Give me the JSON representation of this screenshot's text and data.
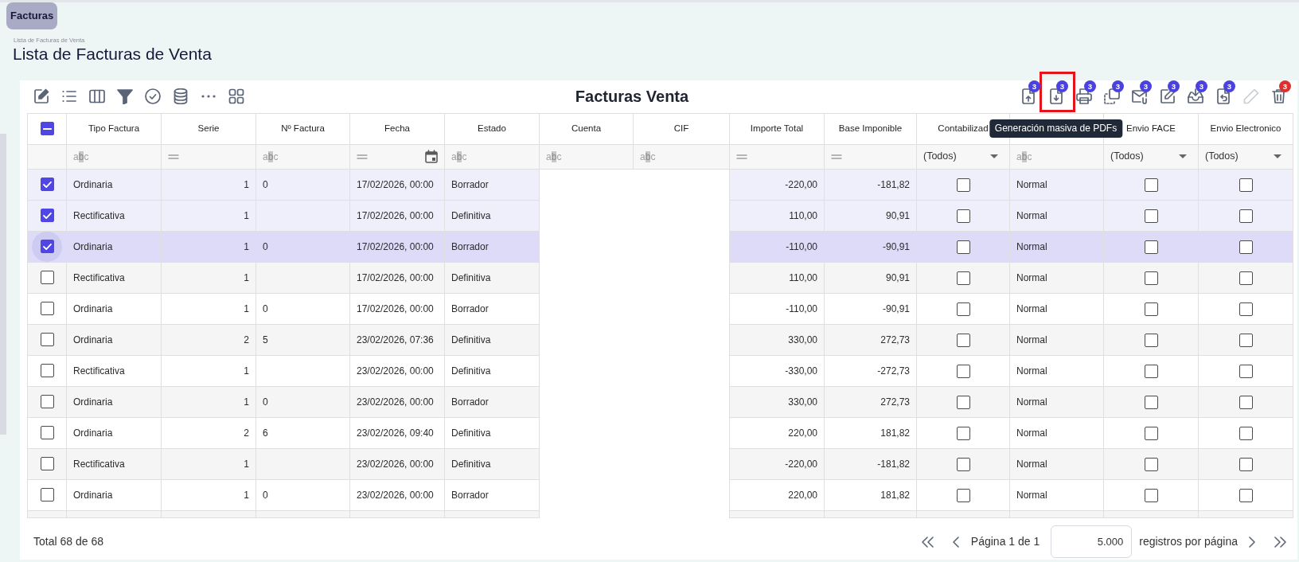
{
  "tab": {
    "label": "Facturas",
    "selected": true
  },
  "breadcrumb": "Lista de Facturas de Venta",
  "page_title": "Lista de Facturas de Venta",
  "grid": {
    "title": "Facturas Venta",
    "left_tools": [
      {
        "kind": "edit"
      },
      {
        "kind": "list"
      },
      {
        "kind": "columns"
      },
      {
        "kind": "filter"
      },
      {
        "kind": "check"
      },
      {
        "kind": "database"
      },
      {
        "kind": "more"
      },
      {
        "kind": "apps"
      }
    ],
    "right_tools": [
      {
        "kind": "upload",
        "badge": {
          "text": "3",
          "color": "#4b41e1"
        },
        "disabled": false,
        "highlighted": false
      },
      {
        "kind": "download",
        "badge": {
          "text": "3",
          "color": "#4b41e1"
        },
        "disabled": false,
        "highlighted": true,
        "tooltip": "Generación masiva de PDFs"
      },
      {
        "kind": "print",
        "badge": {
          "text": "3",
          "color": "#4b41e1"
        },
        "disabled": false,
        "highlighted": false
      },
      {
        "kind": "copy",
        "badge": {
          "text": "3",
          "color": "#4b41e1"
        },
        "disabled": false,
        "highlighted": false
      },
      {
        "kind": "mail",
        "badge": {
          "text": "3",
          "color": "#4b41e1"
        },
        "disabled": false,
        "highlighted": false
      },
      {
        "kind": "edit",
        "badge": {
          "text": "3",
          "color": "#4b41e1"
        },
        "disabled": false,
        "highlighted": false
      },
      {
        "kind": "inbox",
        "badge": {
          "text": "3",
          "color": "#4b41e1"
        },
        "disabled": false,
        "highlighted": false
      },
      {
        "kind": "undo",
        "badge": {
          "text": "3",
          "color": "#4b41e1"
        },
        "disabled": false,
        "highlighted": false
      },
      {
        "kind": "pencil",
        "disabled": true,
        "highlighted": false
      },
      {
        "kind": "trash",
        "badge": {
          "text": "3",
          "color": "#e0302d"
        },
        "disabled": false,
        "highlighted": false
      }
    ],
    "select_all": {
      "checked": true,
      "partial": true
    },
    "columns": [
      {
        "label": "Tipo Factura",
        "kind": "text",
        "filter": {
          "kind": "text",
          "hint": "abc"
        }
      },
      {
        "label": "Serie",
        "kind": "number",
        "filter": {
          "kind": "number"
        }
      },
      {
        "label": "Nº Factura",
        "kind": "text",
        "filter": {
          "kind": "text",
          "hint": "abc"
        }
      },
      {
        "label": "Fecha",
        "kind": "date",
        "filter": {
          "kind": "date"
        }
      },
      {
        "label": "Estado",
        "kind": "text",
        "filter": {
          "kind": "text",
          "hint": "abc"
        }
      },
      {
        "label": "Cuenta",
        "kind": "redacted",
        "filter": {
          "kind": "text",
          "hint": "abc"
        }
      },
      {
        "label": "CIF",
        "kind": "redacted",
        "filter": {
          "kind": "text",
          "hint": "abc"
        }
      },
      {
        "label": "Importe Total",
        "kind": "number",
        "filter": {
          "kind": "number"
        }
      },
      {
        "label": "Base Imponible",
        "kind": "number",
        "filter": {
          "kind": "number"
        }
      },
      {
        "label": "Contabilizad",
        "kind": "check",
        "filter": {
          "kind": "select",
          "value": "(Todos)"
        }
      },
      {
        "kind": "text",
        "filter": {
          "kind": "text",
          "hint": "abc"
        }
      },
      {
        "label": "Envio FACE",
        "kind": "check",
        "filter": {
          "kind": "select",
          "value": "(Todos)"
        }
      },
      {
        "label": "Envio Electronico",
        "kind": "check",
        "filter": {
          "kind": "select",
          "value": "(Todos)"
        }
      }
    ],
    "rows": [
      {
        "selected": true,
        "focused": false,
        "tipo_factura": "Ordinaria",
        "serie": "1",
        "n_factura": "0",
        "fecha": "17/02/2026, 00:00",
        "estado": "Borrador",
        "importe_total": "-220,00",
        "base_imponible": "-181,82",
        "column_11": false,
        "column_12": "Normal",
        "envio_face": false,
        "envio_electronico": false
      },
      {
        "selected": true,
        "focused": false,
        "tipo_factura": "Rectificativa",
        "serie": "1",
        "fecha": "17/02/2026, 00:00",
        "estado": "Definitiva",
        "importe_total": "110,00",
        "base_imponible": "90,91",
        "column_11": false,
        "column_12": "Normal",
        "envio_face": false,
        "envio_electronico": false
      },
      {
        "selected": true,
        "focused": true,
        "tipo_factura": "Ordinaria",
        "serie": "1",
        "n_factura": "0",
        "fecha": "17/02/2026, 00:00",
        "estado": "Borrador",
        "importe_total": "-110,00",
        "base_imponible": "-90,91",
        "column_11": false,
        "column_12": "Normal",
        "envio_face": false,
        "envio_electronico": false
      },
      {
        "selected": false,
        "focused": false,
        "tipo_factura": "Rectificativa",
        "serie": "1",
        "fecha": "17/02/2026, 00:00",
        "estado": "Definitiva",
        "importe_total": "110,00",
        "base_imponible": "90,91",
        "column_11": false,
        "column_12": "Normal",
        "envio_face": false,
        "envio_electronico": false
      },
      {
        "selected": false,
        "focused": false,
        "tipo_factura": "Ordinaria",
        "serie": "1",
        "n_factura": "0",
        "fecha": "17/02/2026, 00:00",
        "estado": "Borrador",
        "importe_total": "-110,00",
        "base_imponible": "-90,91",
        "column_11": false,
        "column_12": "Normal",
        "envio_face": false,
        "envio_electronico": false
      },
      {
        "selected": false,
        "focused": false,
        "tipo_factura": "Ordinaria",
        "serie": "2",
        "n_factura": "5",
        "fecha": "23/02/2026, 07:36",
        "estado": "Definitiva",
        "importe_total": "330,00",
        "base_imponible": "272,73",
        "column_11": false,
        "column_12": "Normal",
        "envio_face": false,
        "envio_electronico": false
      },
      {
        "selected": false,
        "focused": false,
        "tipo_factura": "Rectificativa",
        "serie": "1",
        "fecha": "23/02/2026, 00:00",
        "estado": "Definitiva",
        "importe_total": "-330,00",
        "base_imponible": "-272,73",
        "column_11": false,
        "column_12": "Normal",
        "envio_face": false,
        "envio_electronico": false
      },
      {
        "selected": false,
        "focused": false,
        "tipo_factura": "Ordinaria",
        "serie": "1",
        "n_factura": "0",
        "fecha": "23/02/2026, 00:00",
        "estado": "Borrador",
        "importe_total": "330,00",
        "base_imponible": "272,73",
        "column_11": false,
        "column_12": "Normal",
        "envio_face": false,
        "envio_electronico": false
      },
      {
        "selected": false,
        "focused": false,
        "tipo_factura": "Ordinaria",
        "serie": "2",
        "n_factura": "6",
        "fecha": "23/02/2026, 09:40",
        "estado": "Definitiva",
        "importe_total": "220,00",
        "base_imponible": "181,82",
        "column_11": false,
        "column_12": "Normal",
        "envio_face": false,
        "envio_electronico": false
      },
      {
        "selected": false,
        "focused": false,
        "tipo_factura": "Rectificativa",
        "serie": "1",
        "fecha": "23/02/2026, 00:00",
        "estado": "Definitiva",
        "importe_total": "-220,00",
        "base_imponible": "-181,82",
        "column_11": false,
        "column_12": "Normal",
        "envio_face": false,
        "envio_electronico": false
      },
      {
        "selected": false,
        "focused": false,
        "tipo_factura": "Ordinaria",
        "serie": "1",
        "n_factura": "0",
        "fecha": "23/02/2026, 00:00",
        "estado": "Borrador",
        "importe_total": "220,00",
        "base_imponible": "181,82",
        "column_11": false,
        "column_12": "Normal",
        "envio_face": false,
        "envio_electronico": false
      }
    ]
  },
  "footer": {
    "total": "Total 68 de 68",
    "page_label": "Página 1 de 1",
    "page_size": "5.000",
    "page_size_label": "registros por página"
  }
}
